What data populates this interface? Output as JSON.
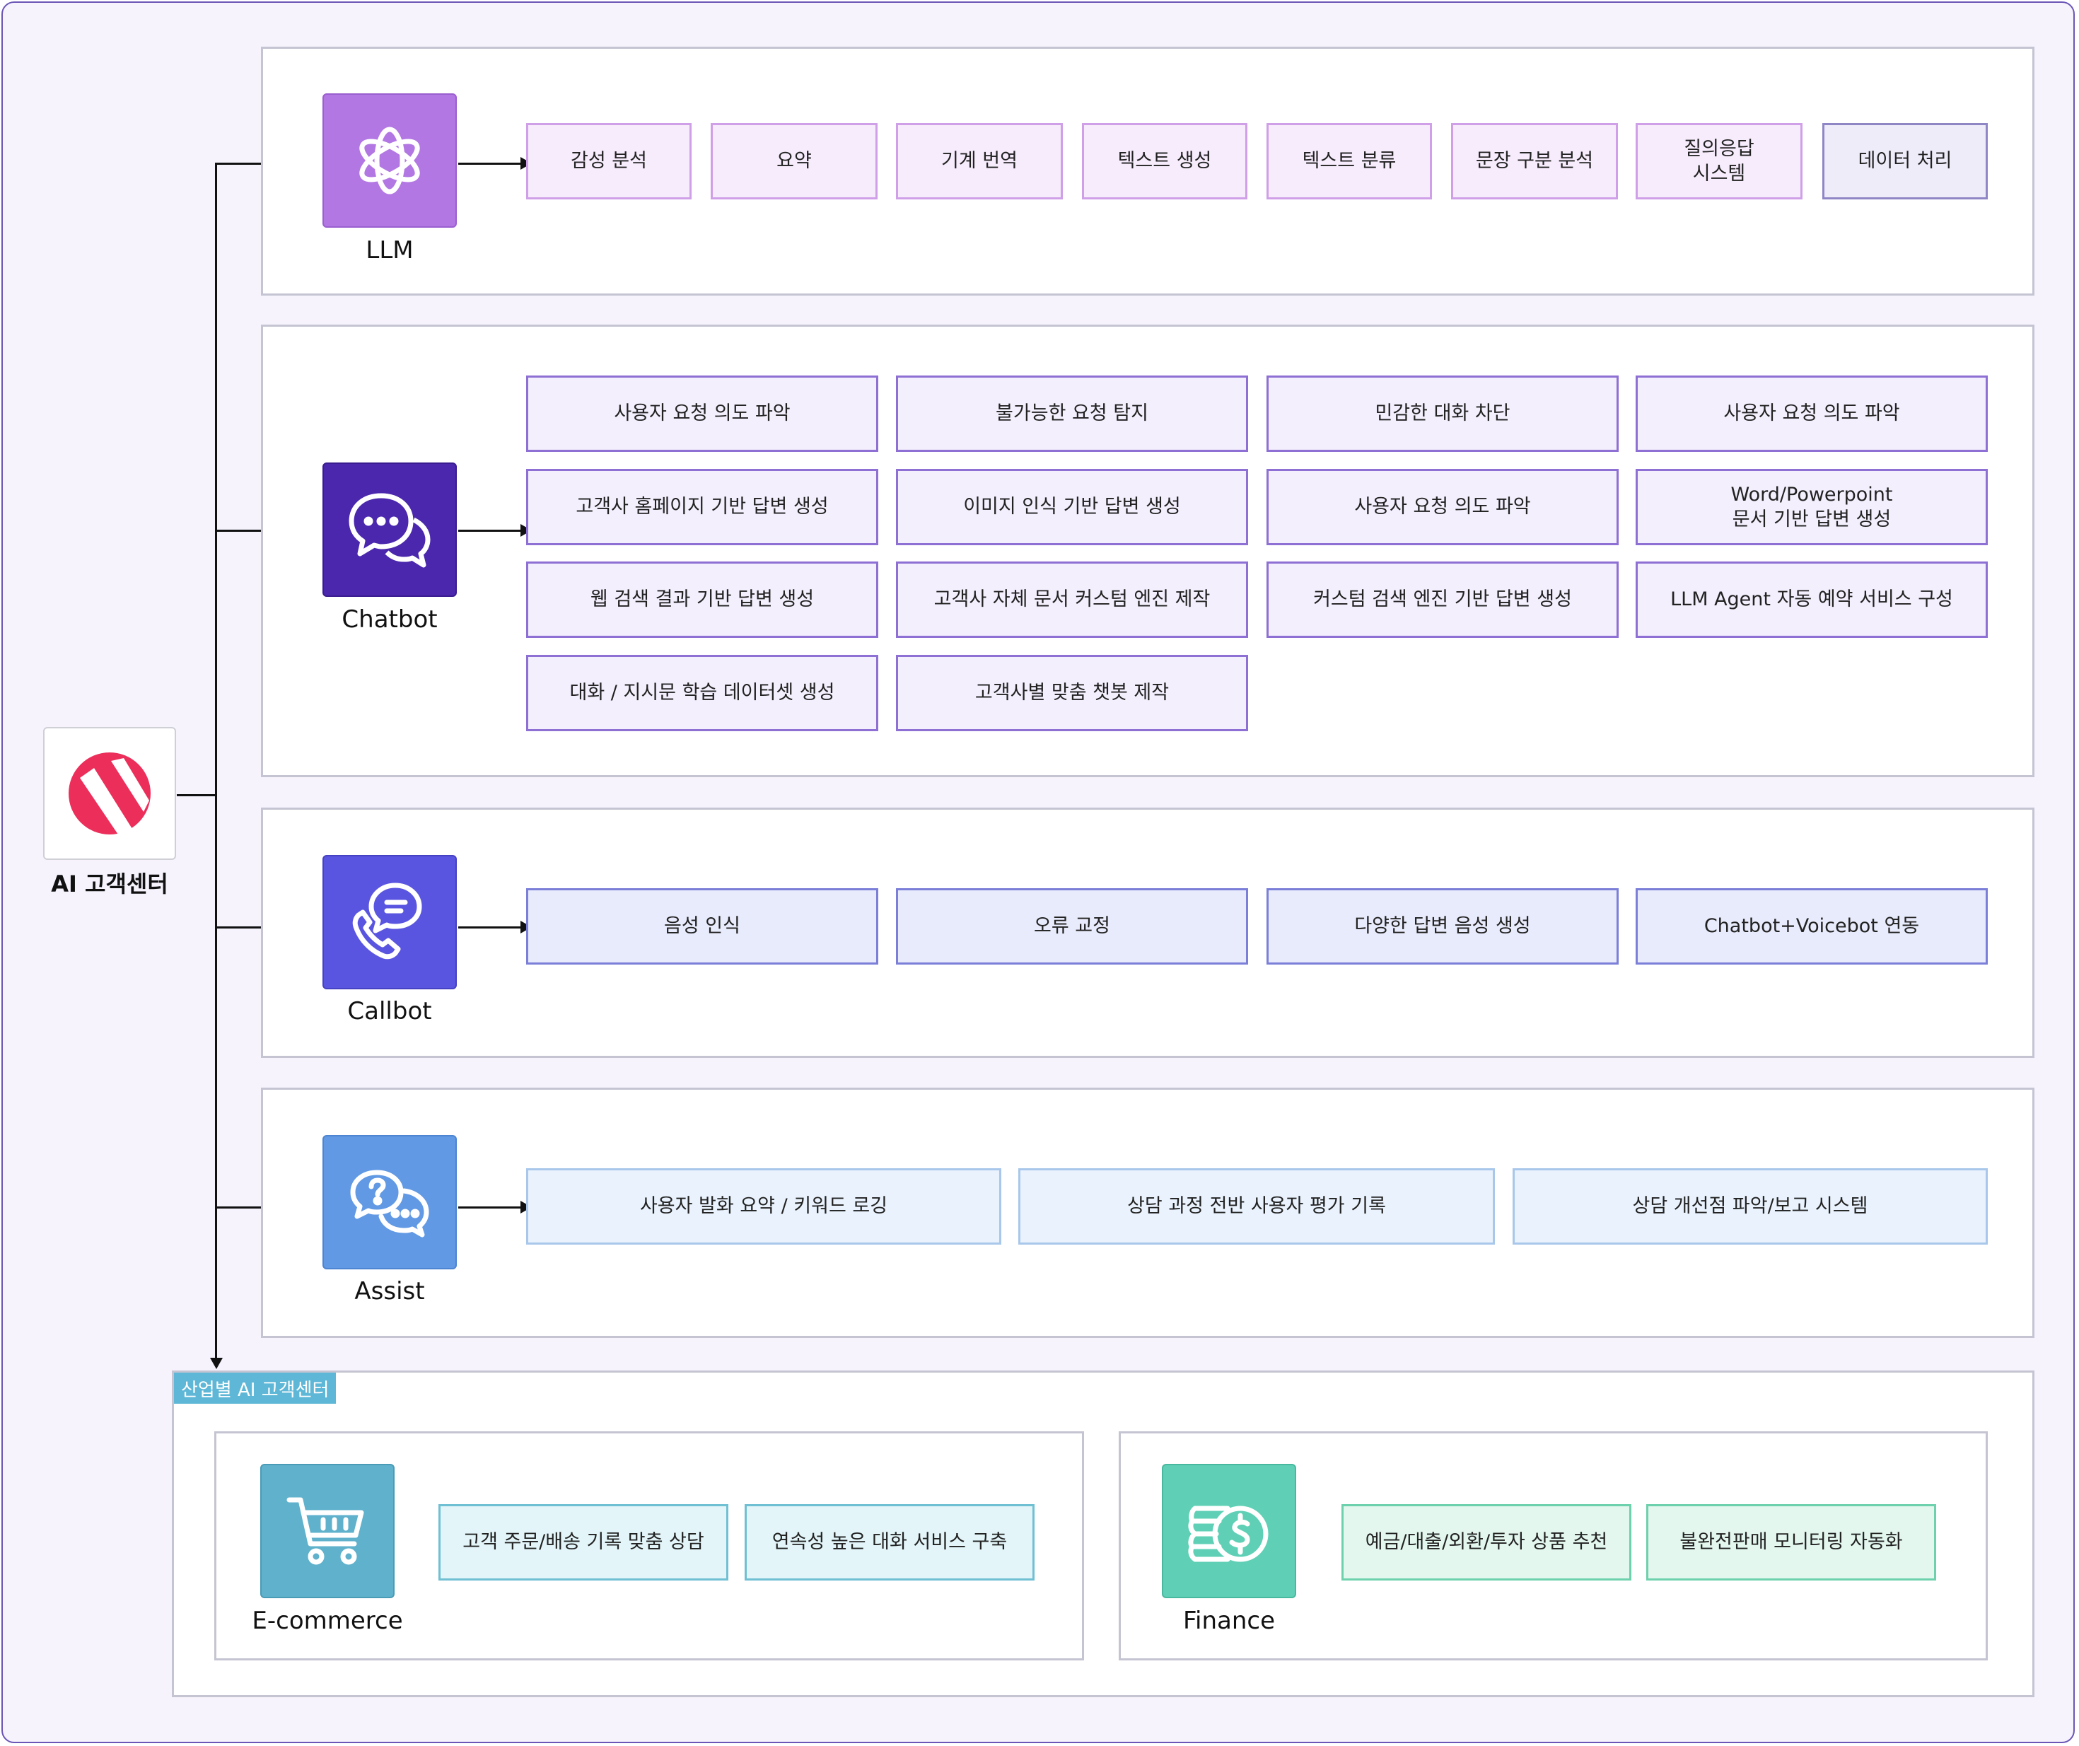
{
  "root": {
    "label": "AI 고객센터"
  },
  "llm": {
    "label": "LLM",
    "items": [
      "감성 분석",
      "요약",
      "기계 번역",
      "텍스트 생성",
      "텍스트 분류",
      "문장 구분 분석",
      "질의응답\n시스템",
      "데이터 처리"
    ]
  },
  "chatbot": {
    "label": "Chatbot",
    "items": [
      "사용자 요청 의도 파악",
      "불가능한 요청 탐지",
      "민감한 대화 차단",
      "사용자 요청 의도 파악",
      "고객사 홈페이지 기반 답변 생성",
      "이미지 인식 기반 답변 생성",
      "사용자 요청 의도 파악",
      "Word/Powerpoint\n문서 기반 답변 생성",
      "웹 검색 결과 기반 답변 생성",
      "고객사 자체 문서 커스텀 엔진 제작",
      "커스텀 검색 엔진 기반 답변 생성",
      "LLM Agent 자동 예약 서비스 구성",
      "대화 / 지시문 학습 데이터셋 생성",
      "고객사별 맞춤 챗봇 제작"
    ]
  },
  "callbot": {
    "label": "Callbot",
    "items": [
      "음성 인식",
      "오류 교정",
      "다양한 답변 음성 생성",
      "Chatbot+Voicebot 연동"
    ]
  },
  "assist": {
    "label": "Assist",
    "items": [
      "사용자 발화 요약 / 키워드 로깅",
      "상담 과정 전반 사용자 평가 기록",
      "상담 개선점 파악/보고 시스템"
    ]
  },
  "industry": {
    "tag": "산업별 AI 고객센터",
    "ecommerce": {
      "label": "E-commerce",
      "items": [
        "고객 주문/배송 기록 맞춤 상담",
        "연속성 높은 대화 서비스 구축"
      ]
    },
    "finance": {
      "label": "Finance",
      "items": [
        "예금/대출/외환/투자 상품 추천",
        "불완전판매 모니터링 자동화"
      ]
    }
  },
  "colors": {
    "llm_icon": "#b277e3",
    "chatbot_icon": "#4a27ad",
    "callbot_icon": "#5a55e0",
    "assist_icon": "#6199e4",
    "ecommerce_icon": "#5fb1cc",
    "finance_icon": "#5fd0b5",
    "logo": "#ec2e5a",
    "frame": "#6b55b6"
  },
  "icons": {
    "root": "logo-icon",
    "llm": "openai-knot-icon",
    "chatbot": "chat-bubbles-icon",
    "callbot": "phone-message-icon",
    "assist": "question-chat-icon",
    "ecommerce": "shopping-cart-icon",
    "finance": "coin-stack-dollar-icon"
  }
}
